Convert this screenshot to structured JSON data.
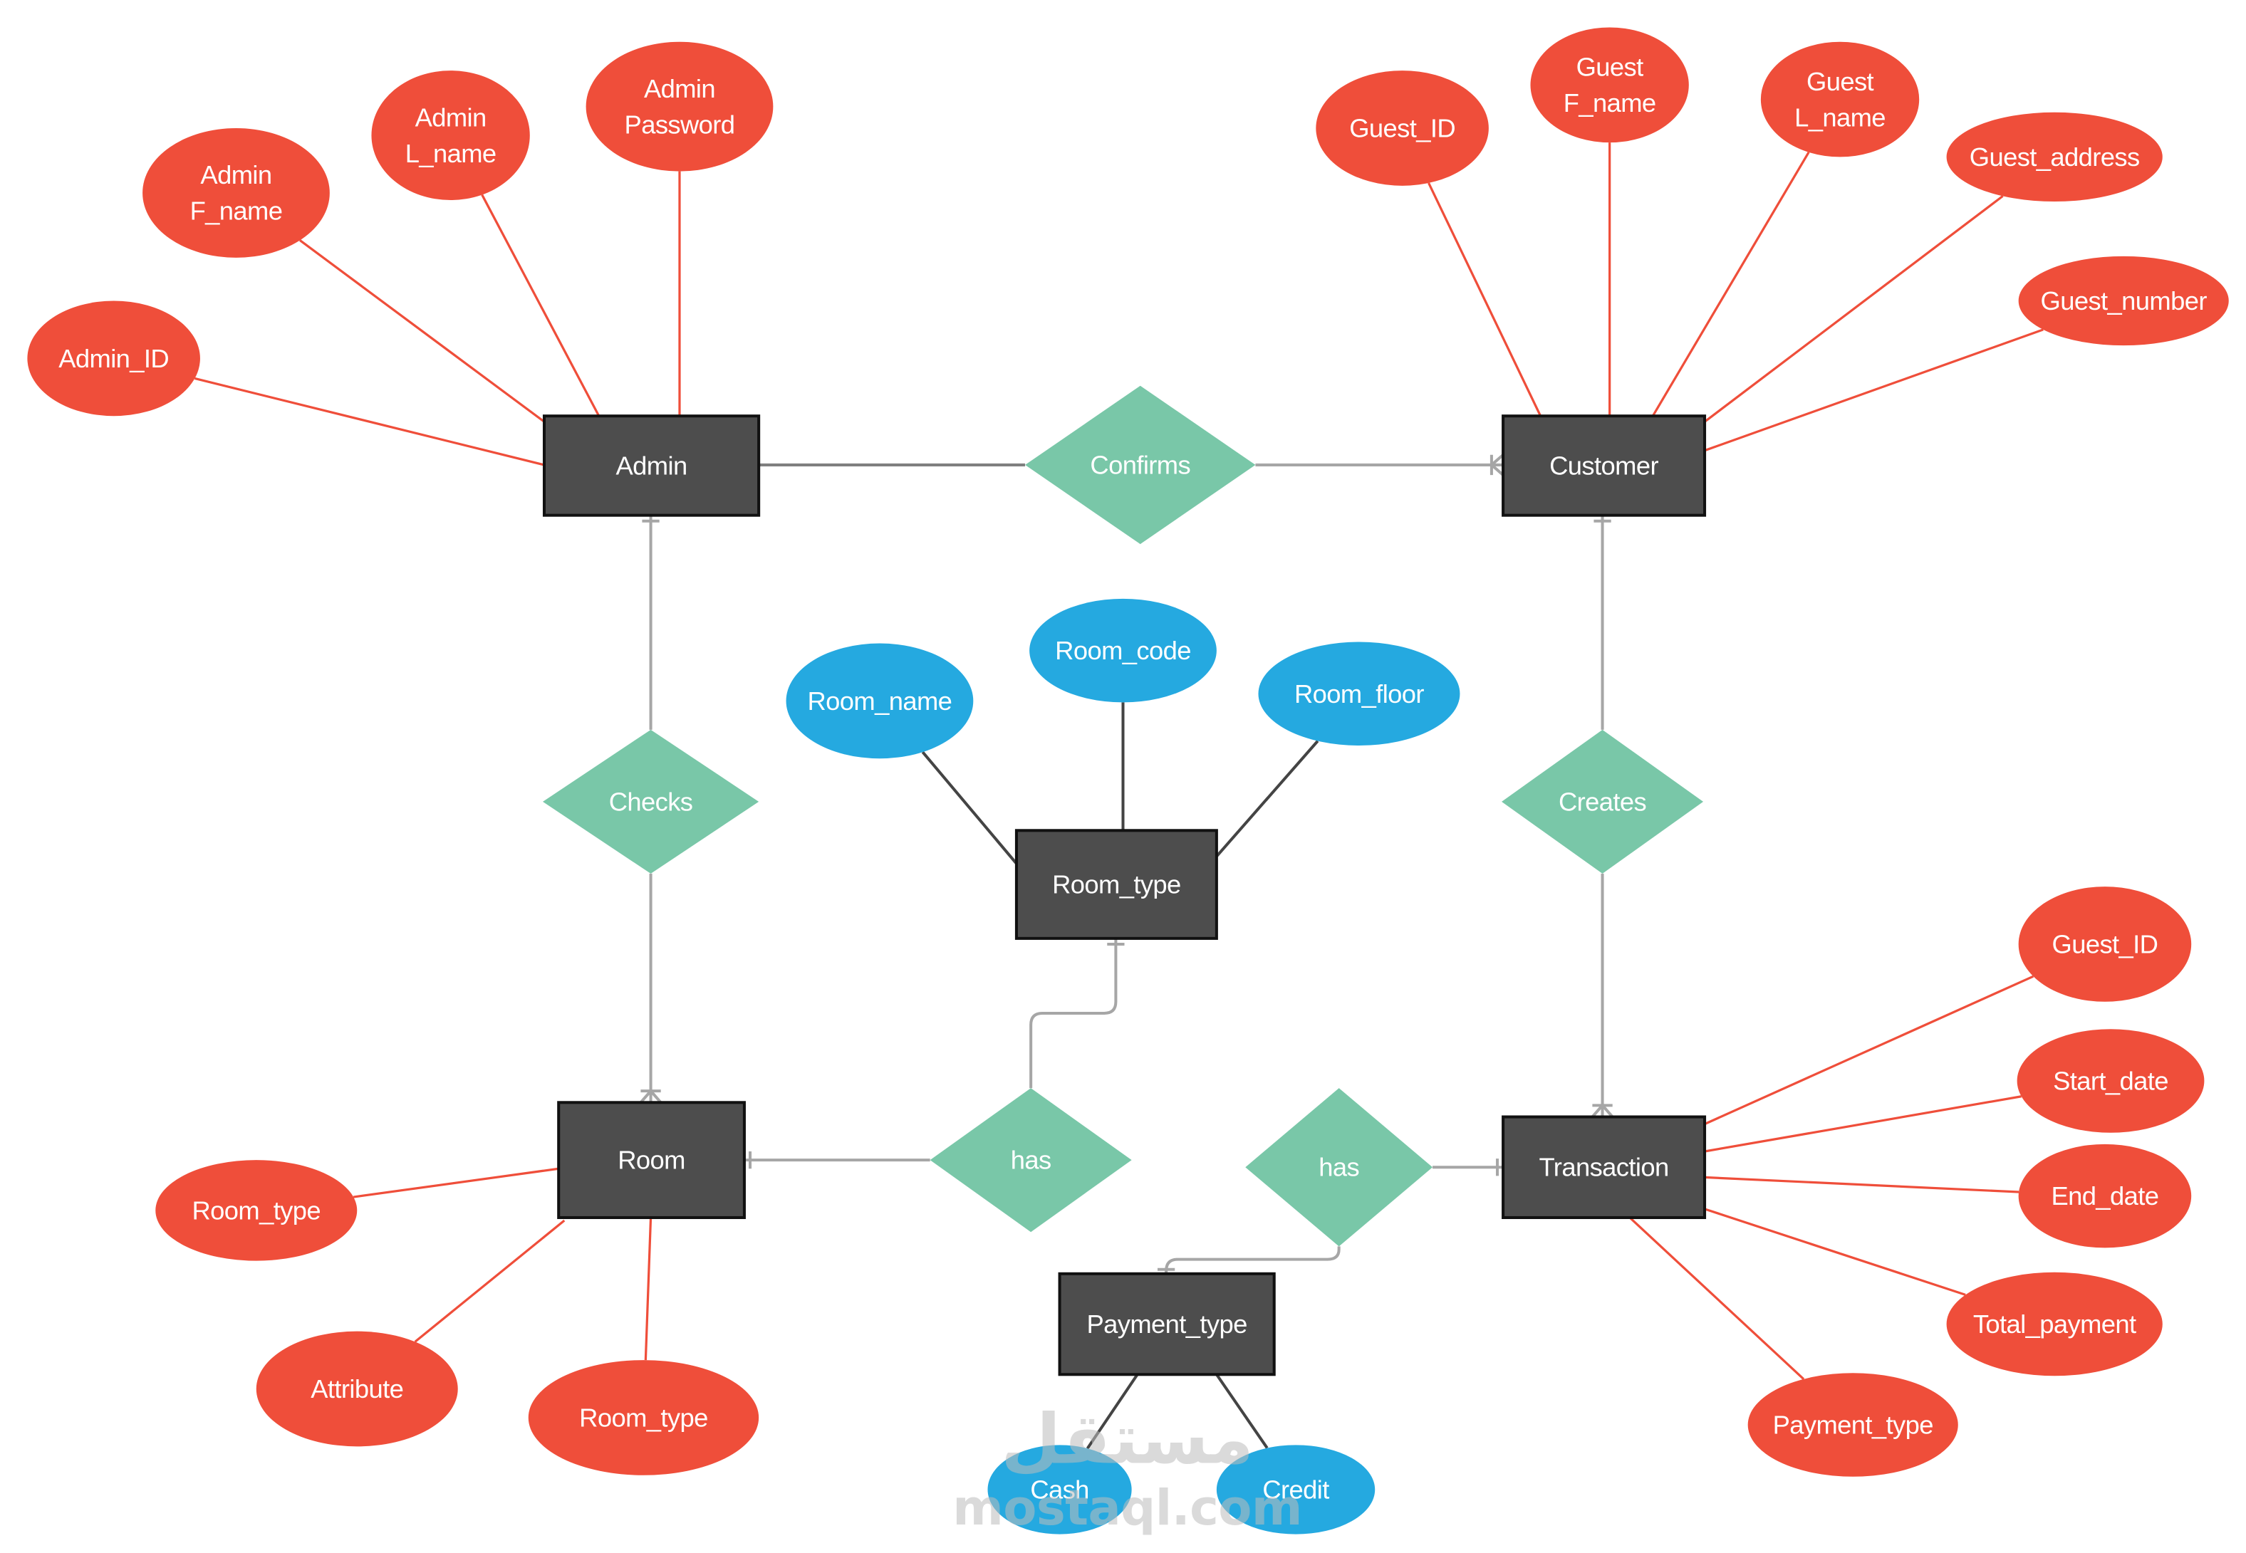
{
  "colors": {
    "entity_fill": "#4d4d4d",
    "entity_border": "#111111",
    "relationship_fill": "#79c7a8",
    "attribute_red": "#ef4e3a",
    "attribute_blue": "#25a9e0",
    "connector_gray": "#a6a6a6",
    "line_dark": "#444444"
  },
  "entities": {
    "admin": "Admin",
    "customer": "Customer",
    "room_type": "Room_type",
    "room": "Room",
    "transaction": "Transaction",
    "payment_type": "Payment_type"
  },
  "relationships": {
    "confirms": "Confirms",
    "checks": "Checks",
    "creates": "Creates",
    "has_room": "has",
    "has_payment": "has"
  },
  "attributes": {
    "admin_id": [
      "Admin_ID"
    ],
    "admin_fname": [
      "Admin",
      "F_name"
    ],
    "admin_lname": [
      "Admin",
      "L_name"
    ],
    "admin_password": [
      "Admin",
      "Password"
    ],
    "guest_id": [
      "Guest_ID"
    ],
    "guest_fname": [
      "Guest",
      "F_name"
    ],
    "guest_lname": [
      "Guest",
      "L_name"
    ],
    "guest_address": [
      "Guest_address"
    ],
    "guest_number": [
      "Guest_number"
    ],
    "room_name": [
      "Room_name"
    ],
    "room_code": [
      "Room_code"
    ],
    "room_floor": [
      "Room_floor"
    ],
    "room_room_type": [
      "Room_type"
    ],
    "room_attribute": [
      "Attribute"
    ],
    "room_room_type_2": [
      "Room_type"
    ],
    "trans_guest_id": [
      "Guest_ID"
    ],
    "trans_start_date": [
      "Start_date"
    ],
    "trans_end_date": [
      "End_date"
    ],
    "trans_total_payment": [
      "Total_payment"
    ],
    "trans_payment_type": [
      "Payment_type"
    ],
    "pay_cash": [
      "Cash"
    ],
    "pay_credit": [
      "Credit"
    ]
  },
  "watermark": {
    "arabic": "مستقل",
    "latin": "mostaql.com"
  }
}
